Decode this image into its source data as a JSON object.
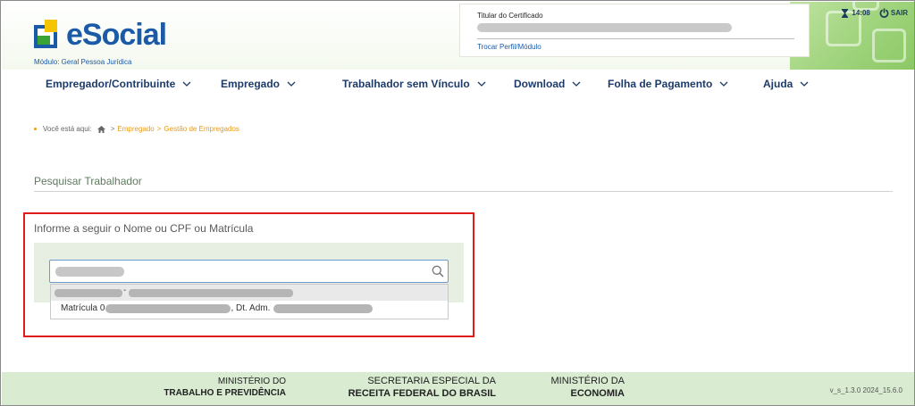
{
  "header": {
    "logo_text": "eSocial",
    "modulo": "Módulo: Geral Pessoa Jurídica",
    "cert_title": "Titular do Certificado",
    "cert_link": "Trocar Perfil/Módulo",
    "time": "14:08",
    "logout": "SAIR"
  },
  "nav": {
    "items": [
      {
        "label": "Empregador/Contribuinte"
      },
      {
        "label": "Empregado"
      },
      {
        "label": "Trabalhador sem Vínculo"
      },
      {
        "label": "Download"
      },
      {
        "label": "Folha de Pagamento"
      },
      {
        "label": "Ajuda"
      }
    ]
  },
  "breadcrumb": {
    "label": "Você está aqui:",
    "sep": ">",
    "items": [
      "Empregado",
      "Gestão de Empregados"
    ]
  },
  "section": {
    "title": "Pesquisar Trabalhador",
    "inform_label": "Informe a seguir o Nome ou CPF ou Matrícula"
  },
  "dropdown": {
    "dash": "-",
    "row2_prefix": "Matrícula 0",
    "row2_mid": ", Dt. Adm."
  },
  "footer": {
    "b1_line1": "MINISTÉRIO DO",
    "b1_line2": "TRABALHO E PREVIDÊNCIA",
    "b2_line1": "SECRETARIA ESPECIAL DA",
    "b2_line2": "RECEITA FEDERAL DO BRASIL",
    "b3_line1": "MINISTÉRIO DA",
    "b3_line2": "ECONOMIA",
    "version": "v_s_1.3.0 2024_15.6.0"
  },
  "colors": {
    "brand_blue": "#1b5aa7",
    "nav_text": "#1d3b6a",
    "breadcrumb_link": "#e89a1c",
    "highlight_red": "#e01b1b",
    "footer_bg": "#d9ecd2"
  },
  "icons": [
    "hourglass-icon",
    "power-icon",
    "chevron-down-icon",
    "home-icon",
    "search-icon"
  ]
}
